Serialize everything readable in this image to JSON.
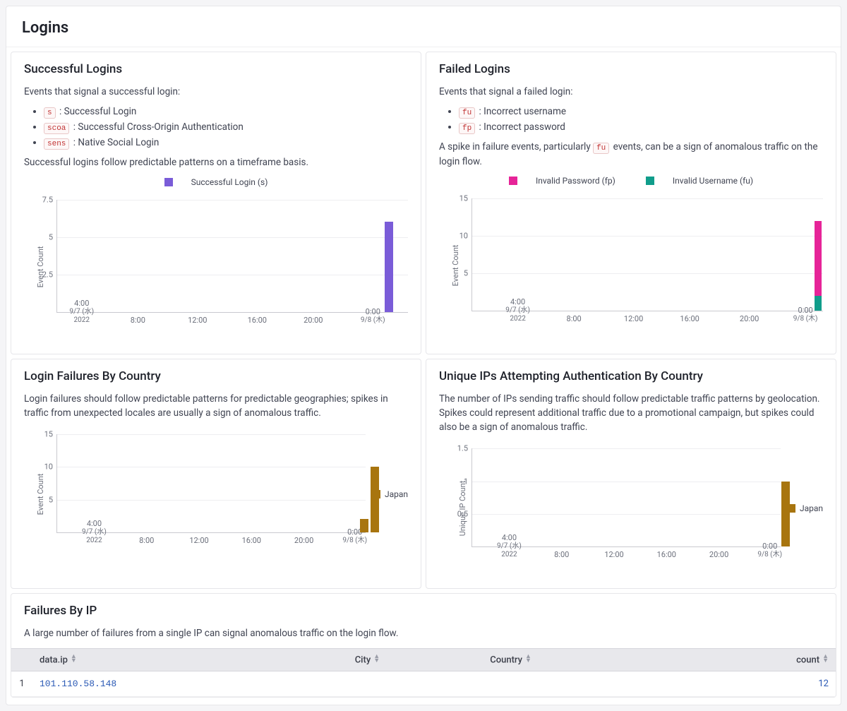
{
  "page_title": "Logins",
  "successful": {
    "title": "Successful Logins",
    "intro": "Events that signal a successful login:",
    "bullets": [
      {
        "code": "s",
        "desc": "Successful Login"
      },
      {
        "code": "scoa",
        "desc": "Successful Cross-Origin Authentication"
      },
      {
        "code": "sens",
        "desc": "Native Social Login"
      }
    ],
    "note": "Successful logins follow predictable patterns on a timeframe basis.",
    "legend": "Successful Login (s)"
  },
  "failed": {
    "title": "Failed Logins",
    "intro": "Events that signal a failed login:",
    "bullets": [
      {
        "code": "fu",
        "desc": "Incorrect username"
      },
      {
        "code": "fp",
        "desc": "Incorrect password"
      }
    ],
    "note_pre": "A spike in failure events, particularly ",
    "note_code": "fu",
    "note_post": " events, can be a sign of anomalous traffic on the login flow.",
    "legend_fp": "Invalid Password (fp)",
    "legend_fu": "Invalid Username (fu)"
  },
  "failures_country": {
    "title": "Login Failures By Country",
    "note": "Login failures should follow predictable patterns for predictable geographies; spikes in traffic from unexpected locales are usually a sign of anomalous traffic.",
    "legend": "Japan"
  },
  "unique_ips": {
    "title": "Unique IPs Attempting Authentication By Country",
    "note": "The number of IPs sending traffic should follow predictable traffic patterns by geolocation. Spikes could represent additional traffic due to a promotional campaign, but spikes could also be a sign of anomalous traffic.",
    "legend": "Japan"
  },
  "failures_ip": {
    "title": "Failures By IP",
    "note": "A large number of failures from a single IP can signal anomalous traffic on the login flow.",
    "columns": {
      "c0": "data.ip",
      "c1": "City",
      "c2": "Country",
      "c3": "count"
    },
    "rows": [
      {
        "idx": "1",
        "ip": "101.110.58.148",
        "city": "",
        "country": "",
        "count": "12"
      }
    ]
  },
  "axes": {
    "event_count": "Event Count",
    "unique_ip_count": "Unique IP Count"
  },
  "colors": {
    "purple": "#7a5cd8",
    "magenta": "#e62498",
    "teal": "#109d8b",
    "olive": "#a8750f"
  },
  "chart_data": [
    {
      "id": "successful_logins",
      "type": "bar",
      "title": "Successful Login (s)",
      "ylabel": "Event Count",
      "ylim": [
        0,
        7.5
      ],
      "yticks": [
        2.5,
        5,
        7.5
      ],
      "x_ticks": [
        "4:00 9/7 (水) 2022",
        "8:00",
        "12:00",
        "16:00",
        "20:00",
        "0:00 9/8 (木)"
      ],
      "x_tick_fractions": [
        0.07,
        0.23,
        0.4,
        0.57,
        0.73,
        0.9
      ],
      "series": [
        {
          "name": "Successful Login (s)",
          "color": "#7a5cd8",
          "points": [
            {
              "x_frac": 0.945,
              "value": 6
            }
          ]
        }
      ]
    },
    {
      "id": "failed_logins",
      "type": "bar-stacked",
      "ylabel": "Event Count",
      "ylim": [
        0,
        15
      ],
      "yticks": [
        5,
        10,
        15
      ],
      "x_ticks": [
        "4:00 9/7 (水) 2022",
        "8:00",
        "12:00",
        "16:00",
        "20:00",
        "0:00 9/8 (木)"
      ],
      "x_tick_fractions": [
        0.13,
        0.29,
        0.46,
        0.62,
        0.79,
        0.95
      ],
      "series": [
        {
          "name": "Invalid Password (fp)",
          "color": "#e62498",
          "points": [
            {
              "x_frac": 0.985,
              "value": 10
            }
          ]
        },
        {
          "name": "Invalid Username (fu)",
          "color": "#109d8b",
          "points": [
            {
              "x_frac": 0.985,
              "value": 2
            }
          ]
        }
      ]
    },
    {
      "id": "login_failures_country",
      "type": "bar",
      "ylabel": "Event Count",
      "ylim": [
        0,
        15
      ],
      "yticks": [
        5,
        10,
        15
      ],
      "x_ticks": [
        "4:00 9/7 (水) 2022",
        "8:00",
        "12:00",
        "16:00",
        "20:00",
        "0:00 9/8 (木)"
      ],
      "x_tick_fractions": [
        0.12,
        0.29,
        0.46,
        0.63,
        0.8,
        0.965
      ],
      "series": [
        {
          "name": "Japan",
          "color": "#a8750f",
          "points": [
            {
              "x_frac": 0.995,
              "value": 2
            },
            {
              "x_frac": 1.03,
              "value": 10
            }
          ]
        }
      ]
    },
    {
      "id": "unique_ips_country",
      "type": "bar",
      "ylabel": "Unique IP Count",
      "ylim": [
        0,
        1.5
      ],
      "yticks": [
        0.5,
        1,
        1.5
      ],
      "x_ticks": [
        "4:00 9/7 (水) 2022",
        "8:00",
        "12:00",
        "16:00",
        "20:00",
        "0:00 9/8 (木)"
      ],
      "x_tick_fractions": [
        0.12,
        0.29,
        0.46,
        0.63,
        0.8,
        0.965
      ],
      "series": [
        {
          "name": "Japan",
          "color": "#a8750f",
          "points": [
            {
              "x_frac": 1.015,
              "value": 1
            }
          ]
        }
      ]
    }
  ]
}
